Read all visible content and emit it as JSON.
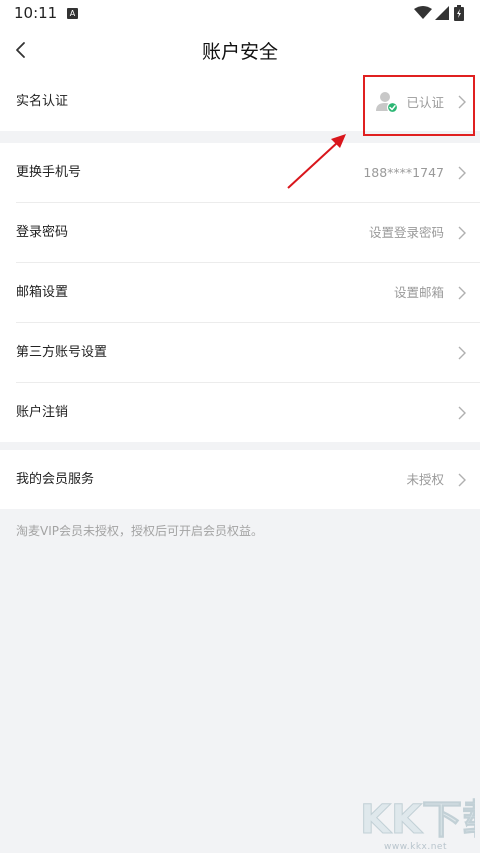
{
  "status_bar": {
    "time": "10:11",
    "notification_glyph": "A"
  },
  "header": {
    "title": "账户安全"
  },
  "sections": [
    {
      "rows": [
        {
          "label": "实名认证",
          "value": "已认证",
          "icon": "verified-user-icon"
        }
      ]
    },
    {
      "rows": [
        {
          "label": "更换手机号",
          "value": "188****1747"
        },
        {
          "label": "登录密码",
          "value": "设置登录密码"
        },
        {
          "label": "邮箱设置",
          "value": "设置邮箱"
        },
        {
          "label": "第三方账号设置",
          "value": ""
        },
        {
          "label": "账户注销",
          "value": ""
        }
      ]
    },
    {
      "rows": [
        {
          "label": "我的会员服务",
          "value": "未授权"
        }
      ]
    }
  ],
  "footnote": "淘麦VIP会员未授权，授权后可开启会员权益。",
  "watermark": {
    "text": "KK下载",
    "url": "www.kkx.net"
  },
  "colors": {
    "highlight": "#e02020",
    "verified_badge": "#2bb673",
    "annotation_arrow": "#d9161c"
  }
}
